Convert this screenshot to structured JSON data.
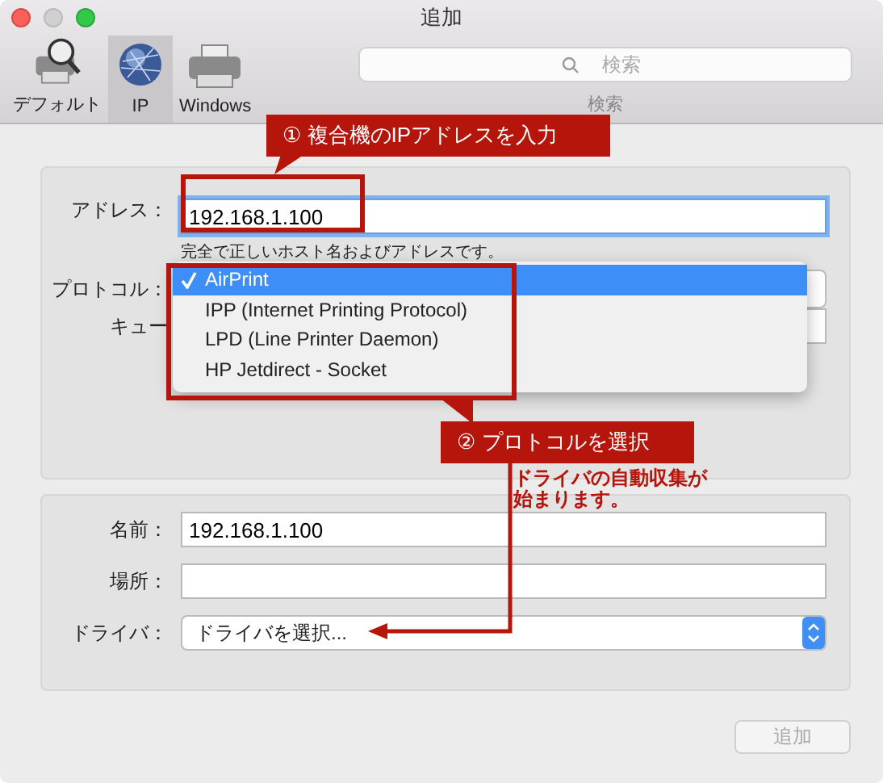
{
  "window": {
    "title": "追加"
  },
  "toolbar": {
    "items": [
      {
        "label": "デフォルト",
        "kind": "default",
        "selected": false
      },
      {
        "label": "IP",
        "kind": "ip",
        "selected": true
      },
      {
        "label": "Windows",
        "kind": "windows",
        "selected": false
      }
    ],
    "search": {
      "placeholder": "検索",
      "label": "検索"
    }
  },
  "connection": {
    "address": {
      "label": "アドレス：",
      "value": "192.168.1.100",
      "hint": "完全で正しいホスト名およびアドレスです。"
    },
    "protocol": {
      "label": "プロトコル：",
      "options": [
        {
          "label": "AirPrint",
          "selected": true
        },
        {
          "label": "IPP (Internet Printing Protocol)",
          "selected": false
        },
        {
          "label": "LPD (Line Printer Daemon)",
          "selected": false
        },
        {
          "label": "HP Jetdirect - Socket",
          "selected": false
        }
      ]
    },
    "queue": {
      "label": "キュー"
    }
  },
  "printer": {
    "name": {
      "label": "名前：",
      "value": "192.168.1.100"
    },
    "location": {
      "label": "場所："
    },
    "driver": {
      "label": "ドライバ：",
      "value": "ドライバを選択..."
    }
  },
  "buttons": [
    {
      "label": "追加",
      "disabled": true
    }
  ],
  "annotations": [
    {
      "text": "① 複合機のIPアドレスを入力"
    },
    {
      "text": "② プロトコルを選択"
    }
  ],
  "note": "ドライバの自動収集が始まります。"
}
